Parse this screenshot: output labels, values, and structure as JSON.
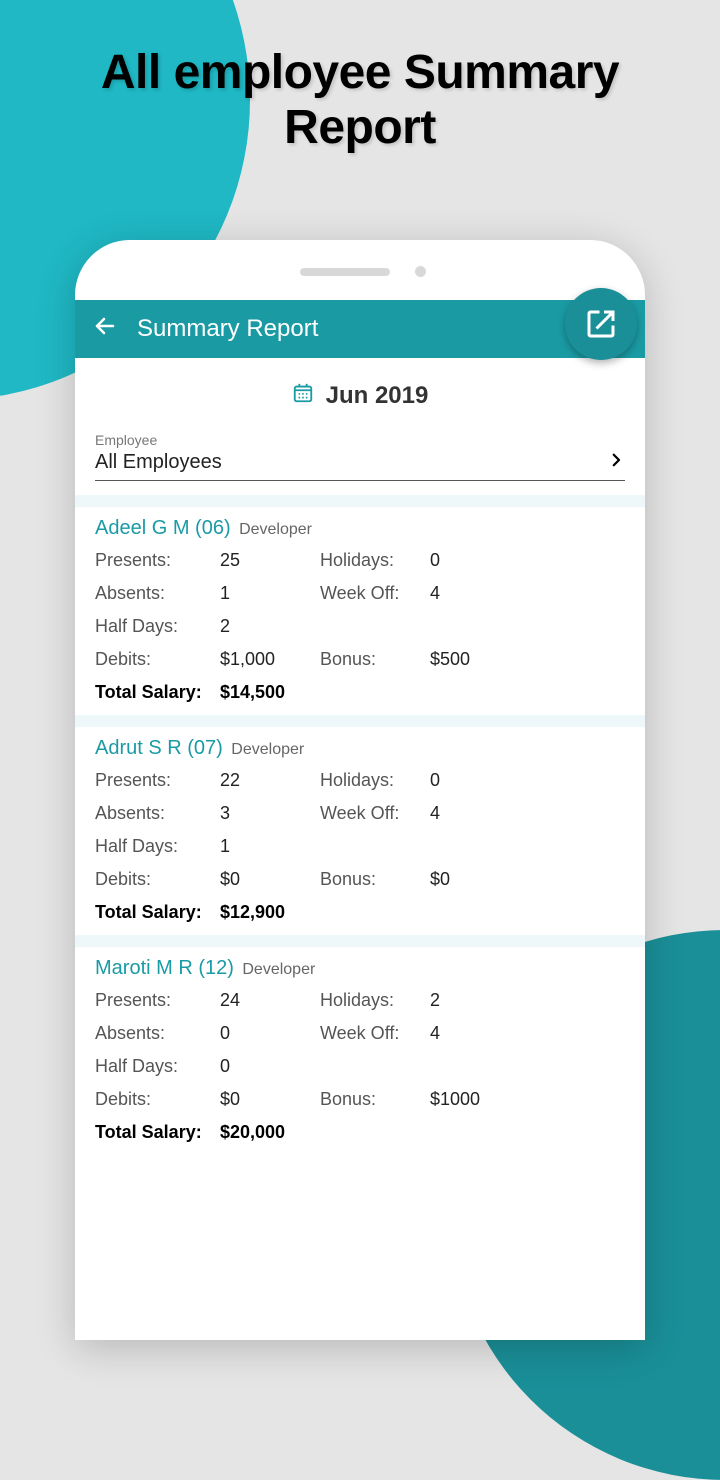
{
  "promo": {
    "title_line1": "All employee Summary",
    "title_line2": "Report"
  },
  "header": {
    "title": "Summary Report"
  },
  "month": "Jun 2019",
  "filter": {
    "label": "Employee",
    "value": "All Employees"
  },
  "labels": {
    "presents": "Presents:",
    "absents": "Absents:",
    "halfdays": "Half Days:",
    "debits": "Debits:",
    "holidays": "Holidays:",
    "weekoff": "Week Off:",
    "bonus": "Bonus:",
    "total": "Total Salary:"
  },
  "employees": [
    {
      "name": "Adeel G M (06)",
      "role": "Developer",
      "presents": "25",
      "holidays": "0",
      "absents": "1",
      "weekoff": "4",
      "halfdays": "2",
      "debits": "$1,000",
      "bonus": "$500",
      "total": "$14,500"
    },
    {
      "name": "Adrut S R (07)",
      "role": "Developer",
      "presents": "22",
      "holidays": "0",
      "absents": "3",
      "weekoff": "4",
      "halfdays": "1",
      "debits": "$0",
      "bonus": "$0",
      "total": "$12,900"
    },
    {
      "name": "Maroti M R (12)",
      "role": "Developer",
      "presents": "24",
      "holidays": "2",
      "absents": "0",
      "weekoff": "4",
      "halfdays": "0",
      "debits": "$0",
      "bonus": "$1000",
      "total": "$20,000"
    }
  ]
}
